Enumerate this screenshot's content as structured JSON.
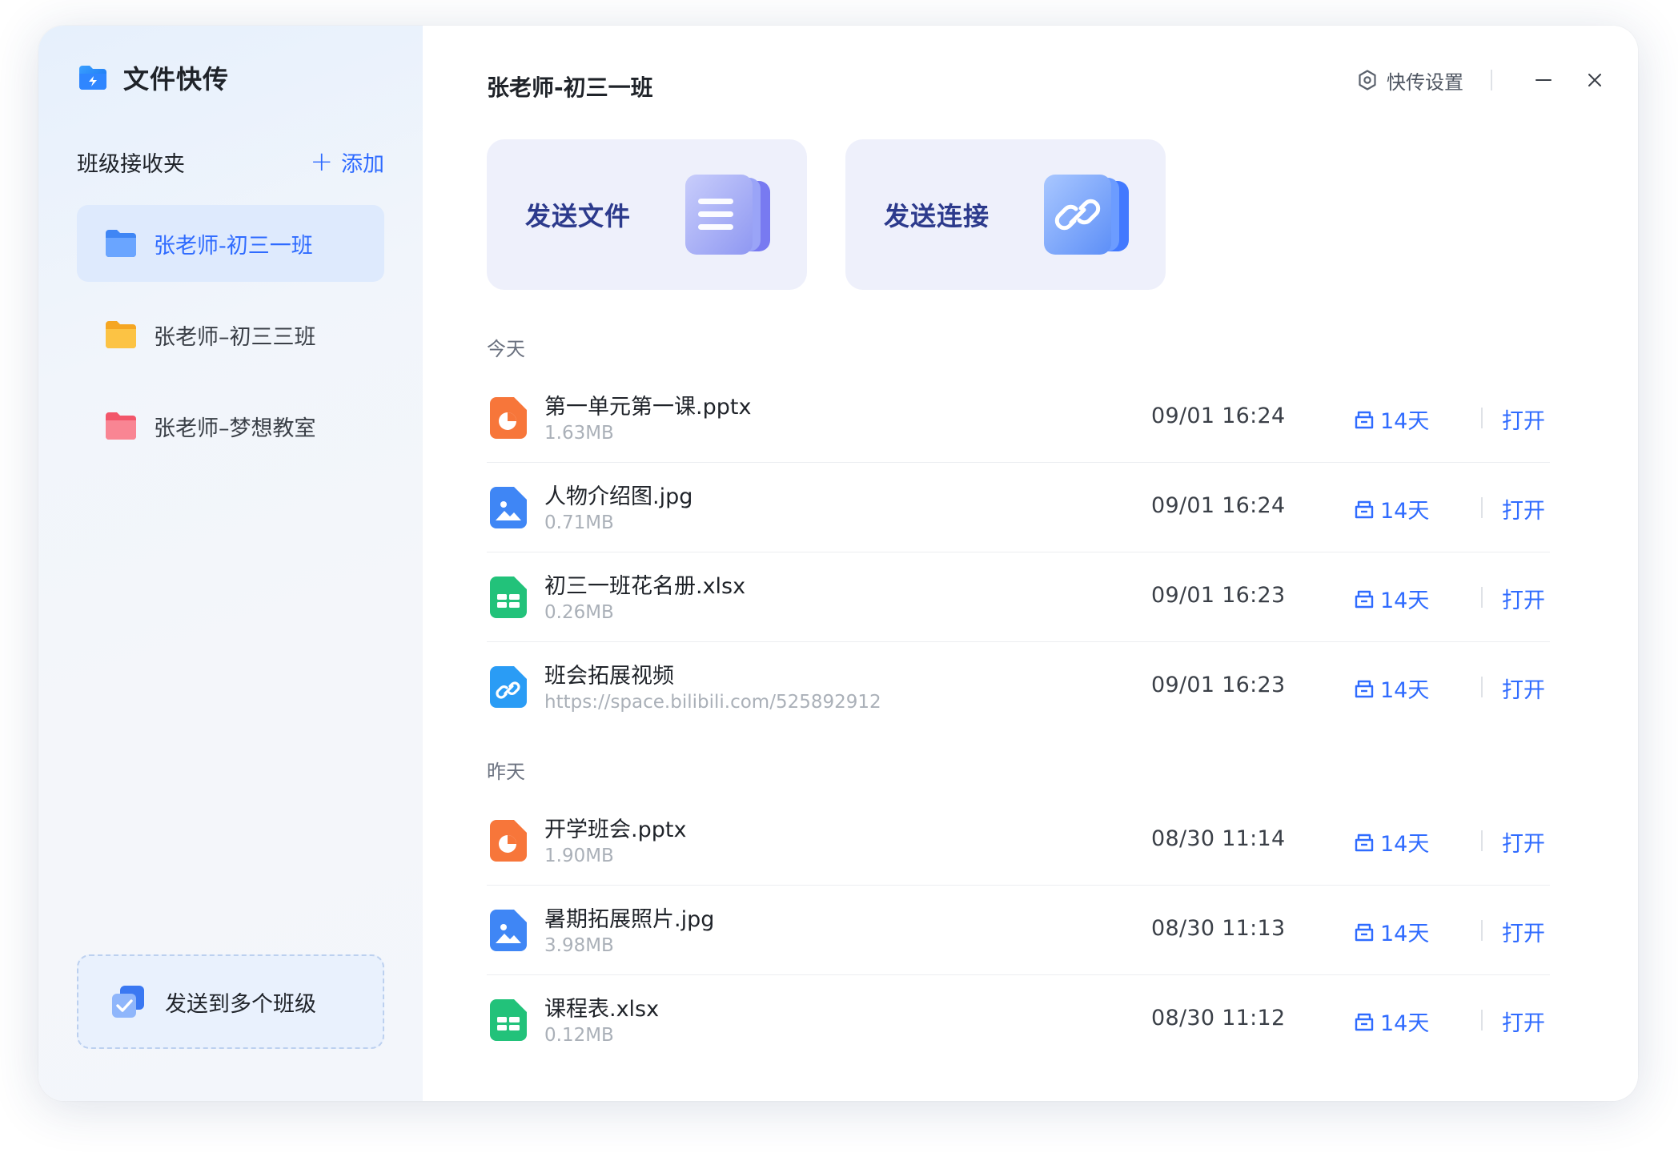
{
  "app": {
    "name": "文件快传"
  },
  "sidebar": {
    "section_title": "班级接收夹",
    "add_label": "添加",
    "folders": [
      {
        "label": "张老师-初三一班",
        "color": "#3f86f5",
        "active": true
      },
      {
        "label": "张老师–初三三班",
        "color": "#f7b531",
        "active": false
      },
      {
        "label": "张老师–梦想教室",
        "color": "#f46a78",
        "active": false
      }
    ],
    "multi_send_label": "发送到多个班级"
  },
  "header": {
    "title": "张老师-初三一班",
    "settings_label": "快传设置"
  },
  "actions": {
    "send_file_label": "发送文件",
    "send_link_label": "发送连接"
  },
  "groups": [
    {
      "label": "今天",
      "items": [
        {
          "name": "第一单元第一课.pptx",
          "meta": "1.63MB",
          "time": "09/01 16:24",
          "expire": "14天",
          "open": "打开",
          "icon": "ppt-file-icon"
        },
        {
          "name": "人物介绍图.jpg",
          "meta": "0.71MB",
          "time": "09/01 16:24",
          "expire": "14天",
          "open": "打开",
          "icon": "image-file-icon"
        },
        {
          "name": "初三一班花名册.xlsx",
          "meta": "0.26MB",
          "time": "09/01 16:23",
          "expire": "14天",
          "open": "打开",
          "icon": "excel-file-icon"
        },
        {
          "name": "班会拓展视频",
          "meta": "https://space.bilibili.com/525892912",
          "time": "09/01 16:23",
          "expire": "14天",
          "open": "打开",
          "icon": "link-file-icon"
        }
      ]
    },
    {
      "label": "昨天",
      "items": [
        {
          "name": "开学班会.pptx",
          "meta": "1.90MB",
          "time": "08/30 11:14",
          "expire": "14天",
          "open": "打开",
          "icon": "ppt-file-icon"
        },
        {
          "name": "暑期拓展照片.jpg",
          "meta": "3.98MB",
          "time": "08/30 11:13",
          "expire": "14天",
          "open": "打开",
          "icon": "image-file-icon"
        },
        {
          "name": "课程表.xlsx",
          "meta": "0.12MB",
          "time": "08/30 11:12",
          "expire": "14天",
          "open": "打开",
          "icon": "excel-file-icon"
        }
      ]
    }
  ],
  "colors": {
    "accent": "#2f6bff",
    "ppt": "#f7763a",
    "image": "#3f86f5",
    "excel": "#22c27a",
    "link": "#2a9cf5",
    "card_title": "#2c3a8c"
  }
}
